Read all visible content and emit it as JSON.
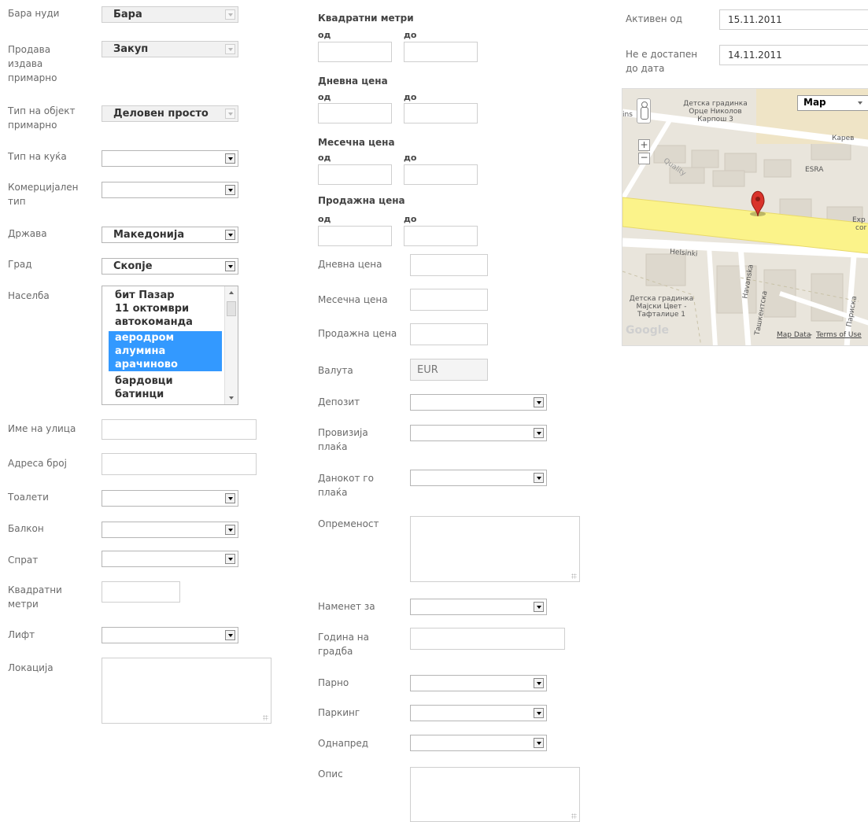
{
  "left": {
    "seeks_label": "Бара нуди",
    "seeks_value": "Бара",
    "sells_label": "Продава издава примарно",
    "sells_value": "Закуп",
    "object_type_label": "Тип на објект примарно",
    "object_type_value": "Деловен просто",
    "house_type_label": "Тип на куќа",
    "commercial_type_label": "Комерцијален тип",
    "country_label": "Држава",
    "country_value": "Македонија",
    "city_label": "Град",
    "city_value": "Скопје",
    "settlement_label": "Населба",
    "settlements": [
      "бит Пазар",
      "11 октомври",
      "автокоманда",
      "аеродром",
      "алумина",
      "арачиново",
      "бардовци",
      "батинци"
    ],
    "street_label": "Име на улица",
    "address_number_label": "Адреса број",
    "toilets_label": "Тоалети",
    "balcony_label": "Балкон",
    "floor_label": "Спрат",
    "square_meters_label": "Квадратни метри",
    "elevator_label": "Лифт",
    "location_label": "Локација"
  },
  "middle": {
    "sqm_group": "Квадратни метри",
    "daily_group": "Дневна цена",
    "monthly_group": "Месечна цена",
    "sale_group": "Продажна цена",
    "from": "од",
    "to": "до",
    "daily_price_label": "Дневна цена",
    "monthly_price_label": "Месечна цена",
    "sale_price_label": "Продажна цена",
    "currency_label": "Валута",
    "currency_value": "EUR",
    "deposit_label": "Депозит",
    "commission_label": "Провизија плаќа",
    "tax_label": "Данокот го плаќа",
    "equipment_label": "Опременост",
    "purpose_label": "Наменет за",
    "year_built_label": "Година на градба",
    "heating_label": "Парно",
    "parking_label": "Паркинг",
    "advance_label": "Однапред",
    "description_label": "Опис"
  },
  "right": {
    "active_from_label": "Активен од",
    "active_from_value": "15.11.2011",
    "unavailable_label": "Не е достапен до дата",
    "unavailable_value": "14.11.2011"
  },
  "map": {
    "type_value": "Map",
    "kindergarten_1": "Детска градинка Орце Николов Карпош 3",
    "karev": "Карев",
    "esra": "ESRA",
    "helsinki": "Helsinki",
    "havanska": "Havanska",
    "kindergarten_2": "Детска градинка Мајски Цвет - Тафталиџе 1",
    "google": "Google",
    "map_data": "Map Data",
    "terms": "Terms of Use",
    "ins": "ins",
    "quality": "Quality",
    "expo_1": "Exp",
    "expo_2": "cor",
    "sashkentska": "Ташкентска",
    "pariska": "Париска",
    "pin_color": "#d9332b",
    "road_color": "#fbf38a"
  }
}
